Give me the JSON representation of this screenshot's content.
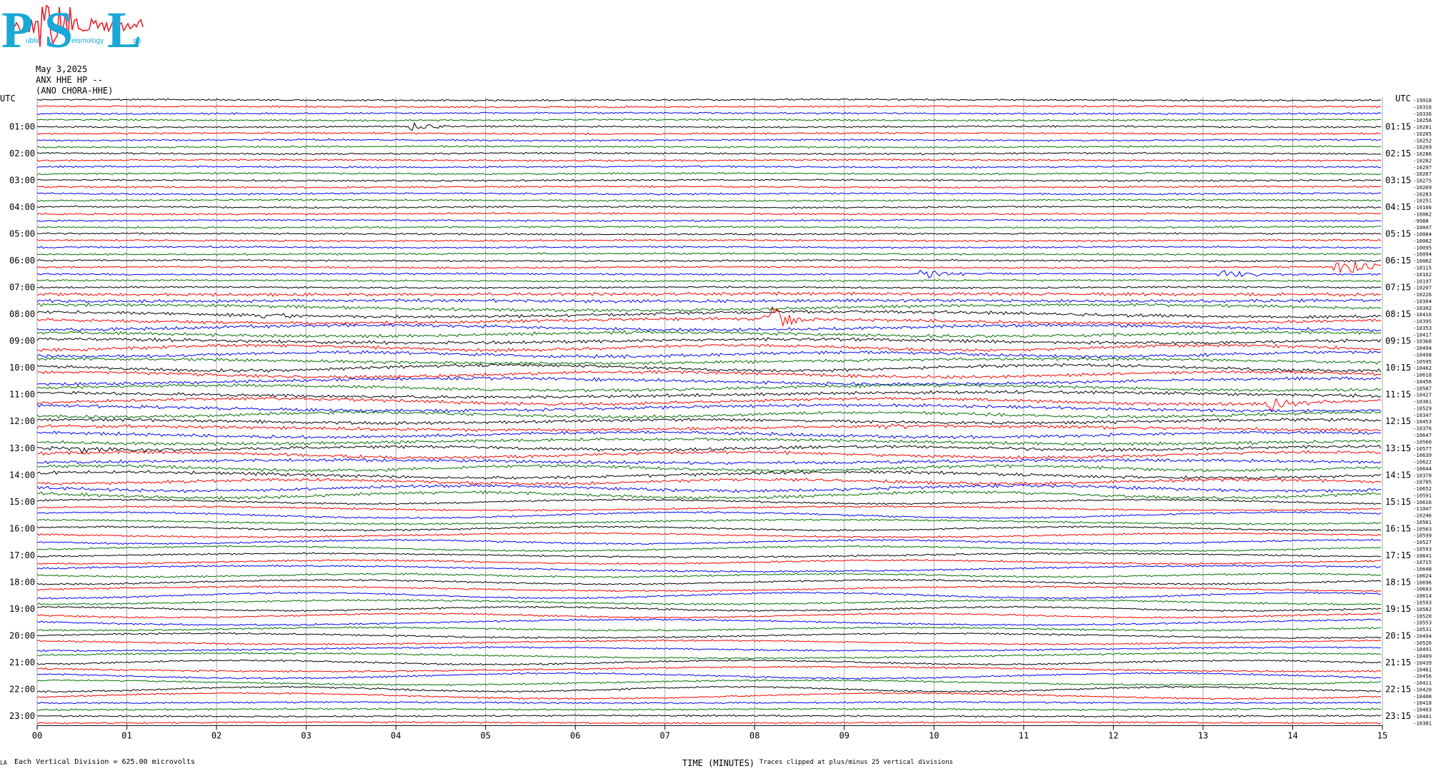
{
  "logo": {
    "letters": [
      "P",
      "S",
      "L"
    ],
    "small_text": [
      "ublic",
      "eismology",
      "ab"
    ]
  },
  "header": {
    "date": "May 3,2025",
    "station": "ANX HHE HP --",
    "location": "(ANO CHORA-HHE)"
  },
  "footer": {
    "corner": "LA",
    "scale": "Each Vertical Division =  625.00 microvolts",
    "x_title": "TIME (MINUTES)",
    "clip_note": "Traces clipped at plus/minus 25 vertical divisions"
  },
  "colors": {
    "cycle": [
      "#000000",
      "#ff0000",
      "#0000ff",
      "#007000"
    ],
    "grid": "#aaaaaa"
  },
  "chart_data": {
    "type": "line",
    "title": "",
    "xlabel": "TIME (MINUTES)",
    "ylabel": "",
    "x_ticks": [
      "00",
      "01",
      "02",
      "03",
      "04",
      "05",
      "06",
      "07",
      "08",
      "09",
      "10",
      "11",
      "12",
      "13",
      "14",
      "15"
    ],
    "xlim": [
      0,
      15
    ],
    "left_unit_label": "UTC",
    "right_unit_label": "UTC",
    "left_hour_labels": [
      "01:00",
      "02:00",
      "03:00",
      "04:00",
      "05:00",
      "06:00",
      "07:00",
      "08:00",
      "09:00",
      "10:00",
      "11:00",
      "12:00",
      "13:00",
      "14:00",
      "15:00",
      "16:00",
      "17:00",
      "18:00",
      "19:00",
      "20:00",
      "21:00",
      "22:00",
      "23:00"
    ],
    "right_hour_labels": [
      "01:15",
      "02:15",
      "03:15",
      "04:15",
      "05:15",
      "06:15",
      "07:15",
      "08:15",
      "09:15",
      "10:15",
      "11:15",
      "12:15",
      "13:15",
      "14:15",
      "15:15",
      "16:15",
      "17:15",
      "18:15",
      "19:15",
      "20:15",
      "21:15",
      "22:15",
      "23:15"
    ],
    "trace_offsets": [
      "-19918",
      "-10316",
      "-10336",
      "-10256",
      "-10281",
      "-10265",
      "-10252",
      "-10269",
      "-10286",
      "-10282",
      "-10297",
      "-10267",
      "-10275",
      "-10269",
      "-10283",
      "-10251",
      "-10166",
      "-10062",
      "-9988",
      "-10047",
      "-10084",
      "-10062",
      "-10095",
      "-10094",
      "-10062",
      "-10115",
      "-10162",
      "-10197",
      "-10207",
      "-10226",
      "-10304",
      "-10302",
      "-10416",
      "-10395",
      "-10353",
      "-10417",
      "-10368",
      "-10494",
      "-10498",
      "-10595",
      "-10462",
      "-10618",
      "-10456",
      "-10587",
      "-10427",
      "-10361",
      "-10529",
      "-10347",
      "-10453",
      "-10376",
      "-10647",
      "-10560",
      "-10577",
      "-10639",
      "-10622",
      "-10644",
      "-10370",
      "-10705",
      "-10652",
      "-10591",
      "-10616",
      "-11047",
      "-10246",
      "-10561",
      "-10563",
      "-10599",
      "-10527",
      "-10593",
      "-10641",
      "-10715",
      "-10648",
      "-10624",
      "-10696",
      "-10603",
      "-10614",
      "-10593",
      "-10582",
      "-10520",
      "-10553",
      "-10531",
      "-10494",
      "-10526",
      "-10491",
      "-10409",
      "-10439",
      "-10461",
      "-10456",
      "-10411",
      "-10420",
      "-10408",
      "-10418",
      "-10403",
      "-10401",
      "-10381"
    ],
    "traces_per_hour": 4,
    "minutes_per_trace": 15,
    "events": [
      {
        "trace": 4,
        "minute": 4.15,
        "amp": 6
      },
      {
        "trace": 25,
        "minute": 14.5,
        "amp": 16
      },
      {
        "trace": 26,
        "minute": 9.8,
        "amp": 10
      },
      {
        "trace": 26,
        "minute": 13.2,
        "amp": 7
      },
      {
        "trace": 33,
        "minute": 8.15,
        "amp": 22
      },
      {
        "trace": 32,
        "minute": 2.5,
        "amp": 6
      },
      {
        "trace": 45,
        "minute": 13.7,
        "amp": 12
      },
      {
        "trace": 49,
        "minute": 9.4,
        "amp": 6
      },
      {
        "trace": 52,
        "minute": 0.5,
        "amp": 8
      }
    ]
  }
}
